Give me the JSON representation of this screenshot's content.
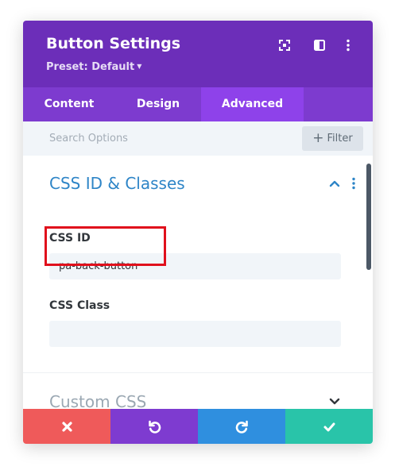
{
  "header": {
    "title": "Button Settings",
    "preset_label": "Preset: Default",
    "icons": [
      "expand-icon",
      "sidebar-layout-icon",
      "more-options-icon"
    ]
  },
  "tabs": [
    {
      "label": "Content",
      "active": false
    },
    {
      "label": "Design",
      "active": false
    },
    {
      "label": "Advanced",
      "active": true
    }
  ],
  "search": {
    "placeholder": "Search Options",
    "filter_label": "Filter"
  },
  "sections": {
    "css_id_classes": {
      "title": "CSS ID & Classes",
      "expanded": true,
      "fields": {
        "css_id": {
          "label": "CSS ID",
          "value": "pa-back-button"
        },
        "css_class": {
          "label": "CSS Class",
          "value": ""
        }
      }
    },
    "custom_css": {
      "title": "Custom CSS",
      "expanded": false
    }
  },
  "footer": {
    "buttons": [
      "cancel",
      "undo",
      "redo",
      "save"
    ]
  },
  "colors": {
    "header_purple": "#6c2eb9",
    "tab_bar_purple": "#7d3bcf",
    "active_tab_purple": "#8e42ea",
    "section_title_blue": "#2e85c7",
    "highlight_red": "#e0101c",
    "cancel_red": "#ef5a5a",
    "undo_purple": "#7e3bd0",
    "redo_blue": "#2f8fdf",
    "save_green": "#29c4a9"
  }
}
